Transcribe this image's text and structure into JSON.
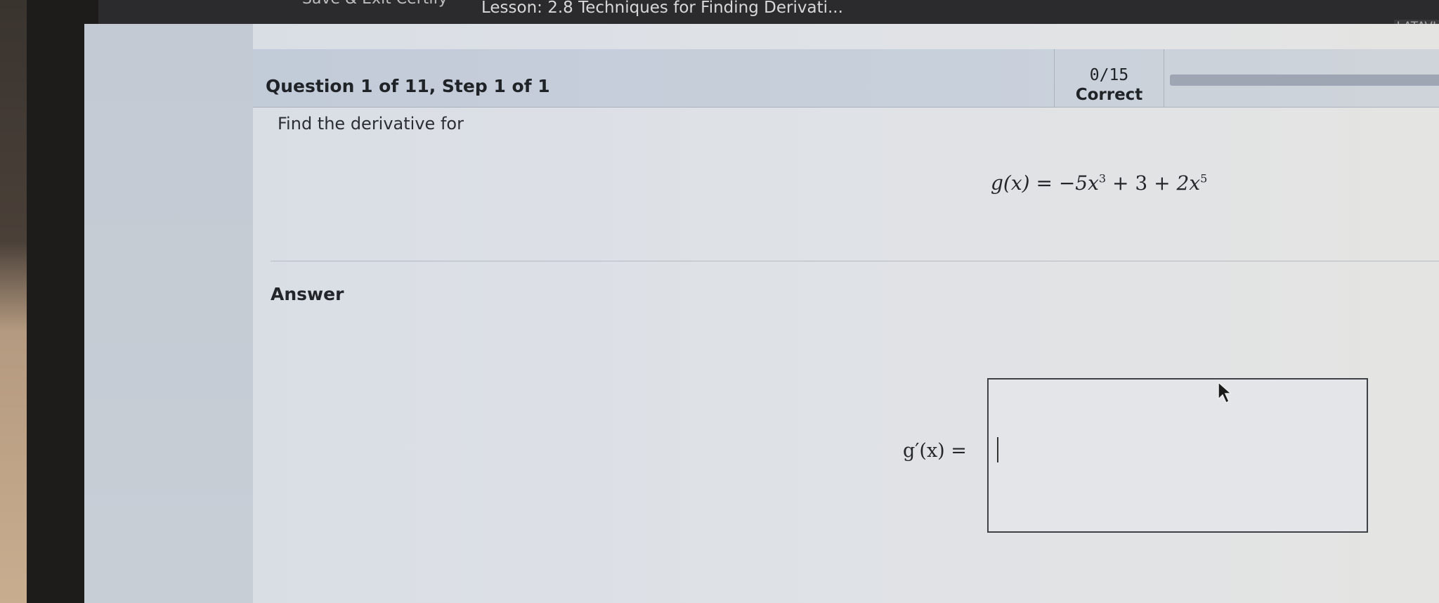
{
  "topbar": {
    "exit_label": "Save & Exit Certify",
    "lesson_title": "Lesson: 2.8 Techniques for Finding Derivati...",
    "user_name": "LATAVI"
  },
  "question": {
    "title": "Question 1 of 11, Step 1 of 1",
    "score": "0/15",
    "score_status": "Correct",
    "progress_fraction": 0,
    "prompt": "Find the derivative for",
    "equation": {
      "lhs": "g(x)",
      "eq": "=",
      "term1": "−5x",
      "exp1": "3",
      "op1": "+",
      "term2": "3",
      "op2": "+",
      "term3": "2x",
      "exp3": "5"
    }
  },
  "answer": {
    "label": "Answer",
    "lhs": "g′(x) =",
    "value": ""
  }
}
